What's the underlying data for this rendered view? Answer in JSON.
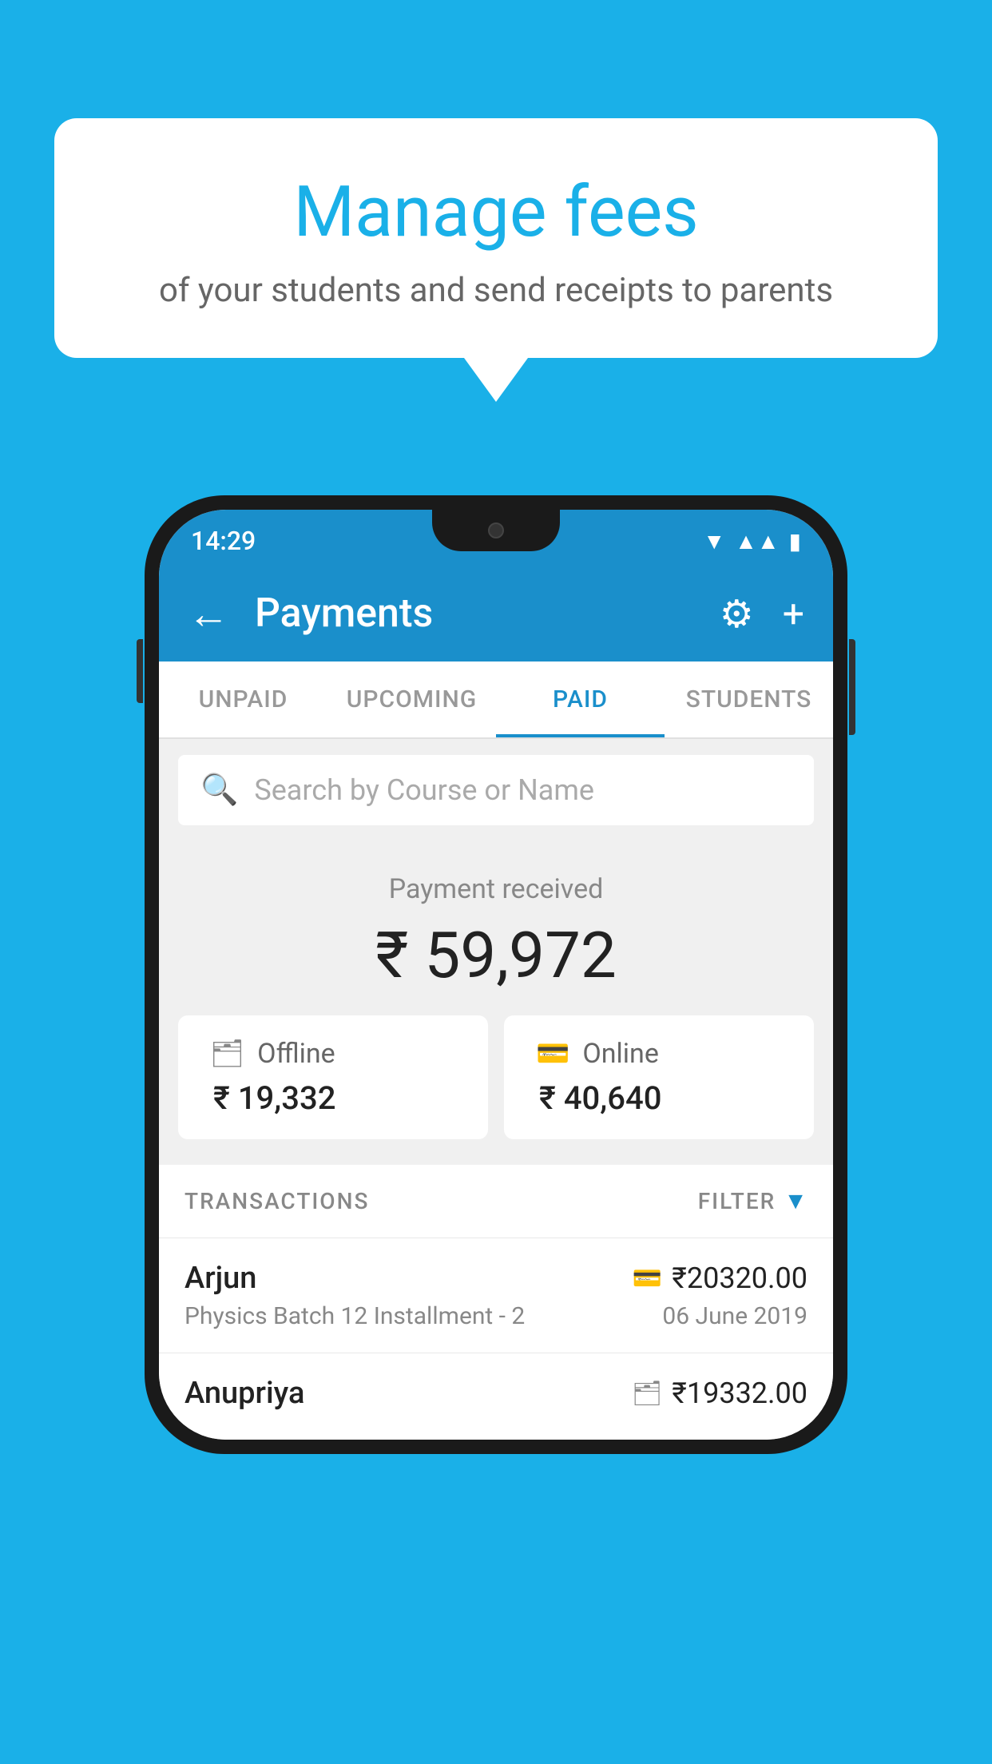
{
  "background": {
    "color": "#1ab0e8"
  },
  "speech_bubble": {
    "title": "Manage fees",
    "subtitle": "of your students and send receipts to parents"
  },
  "phone": {
    "status_bar": {
      "time": "14:29",
      "icons": [
        "▼▲",
        "▲",
        "█"
      ]
    },
    "app_bar": {
      "back_label": "←",
      "title": "Payments",
      "settings_icon": "⚙",
      "add_icon": "+"
    },
    "tabs": [
      {
        "label": "UNPAID",
        "active": false
      },
      {
        "label": "UPCOMING",
        "active": false
      },
      {
        "label": "PAID",
        "active": true
      },
      {
        "label": "STUDENTS",
        "active": false
      }
    ],
    "search": {
      "placeholder": "Search by Course or Name",
      "icon": "🔍"
    },
    "payment_summary": {
      "label": "Payment received",
      "total_amount": "₹ 59,972",
      "cards": [
        {
          "type": "Offline",
          "icon": "💳",
          "amount": "₹ 19,332"
        },
        {
          "type": "Online",
          "icon": "💳",
          "amount": "₹ 40,640"
        }
      ]
    },
    "transactions": {
      "section_label": "TRANSACTIONS",
      "filter_label": "FILTER",
      "rows": [
        {
          "name": "Arjun",
          "description": "Physics Batch 12 Installment - 2",
          "amount": "₹20320.00",
          "date": "06 June 2019",
          "payment_type": "online"
        },
        {
          "name": "Anupriya",
          "description": "",
          "amount": "₹19332.00",
          "date": "",
          "payment_type": "offline"
        }
      ]
    }
  }
}
